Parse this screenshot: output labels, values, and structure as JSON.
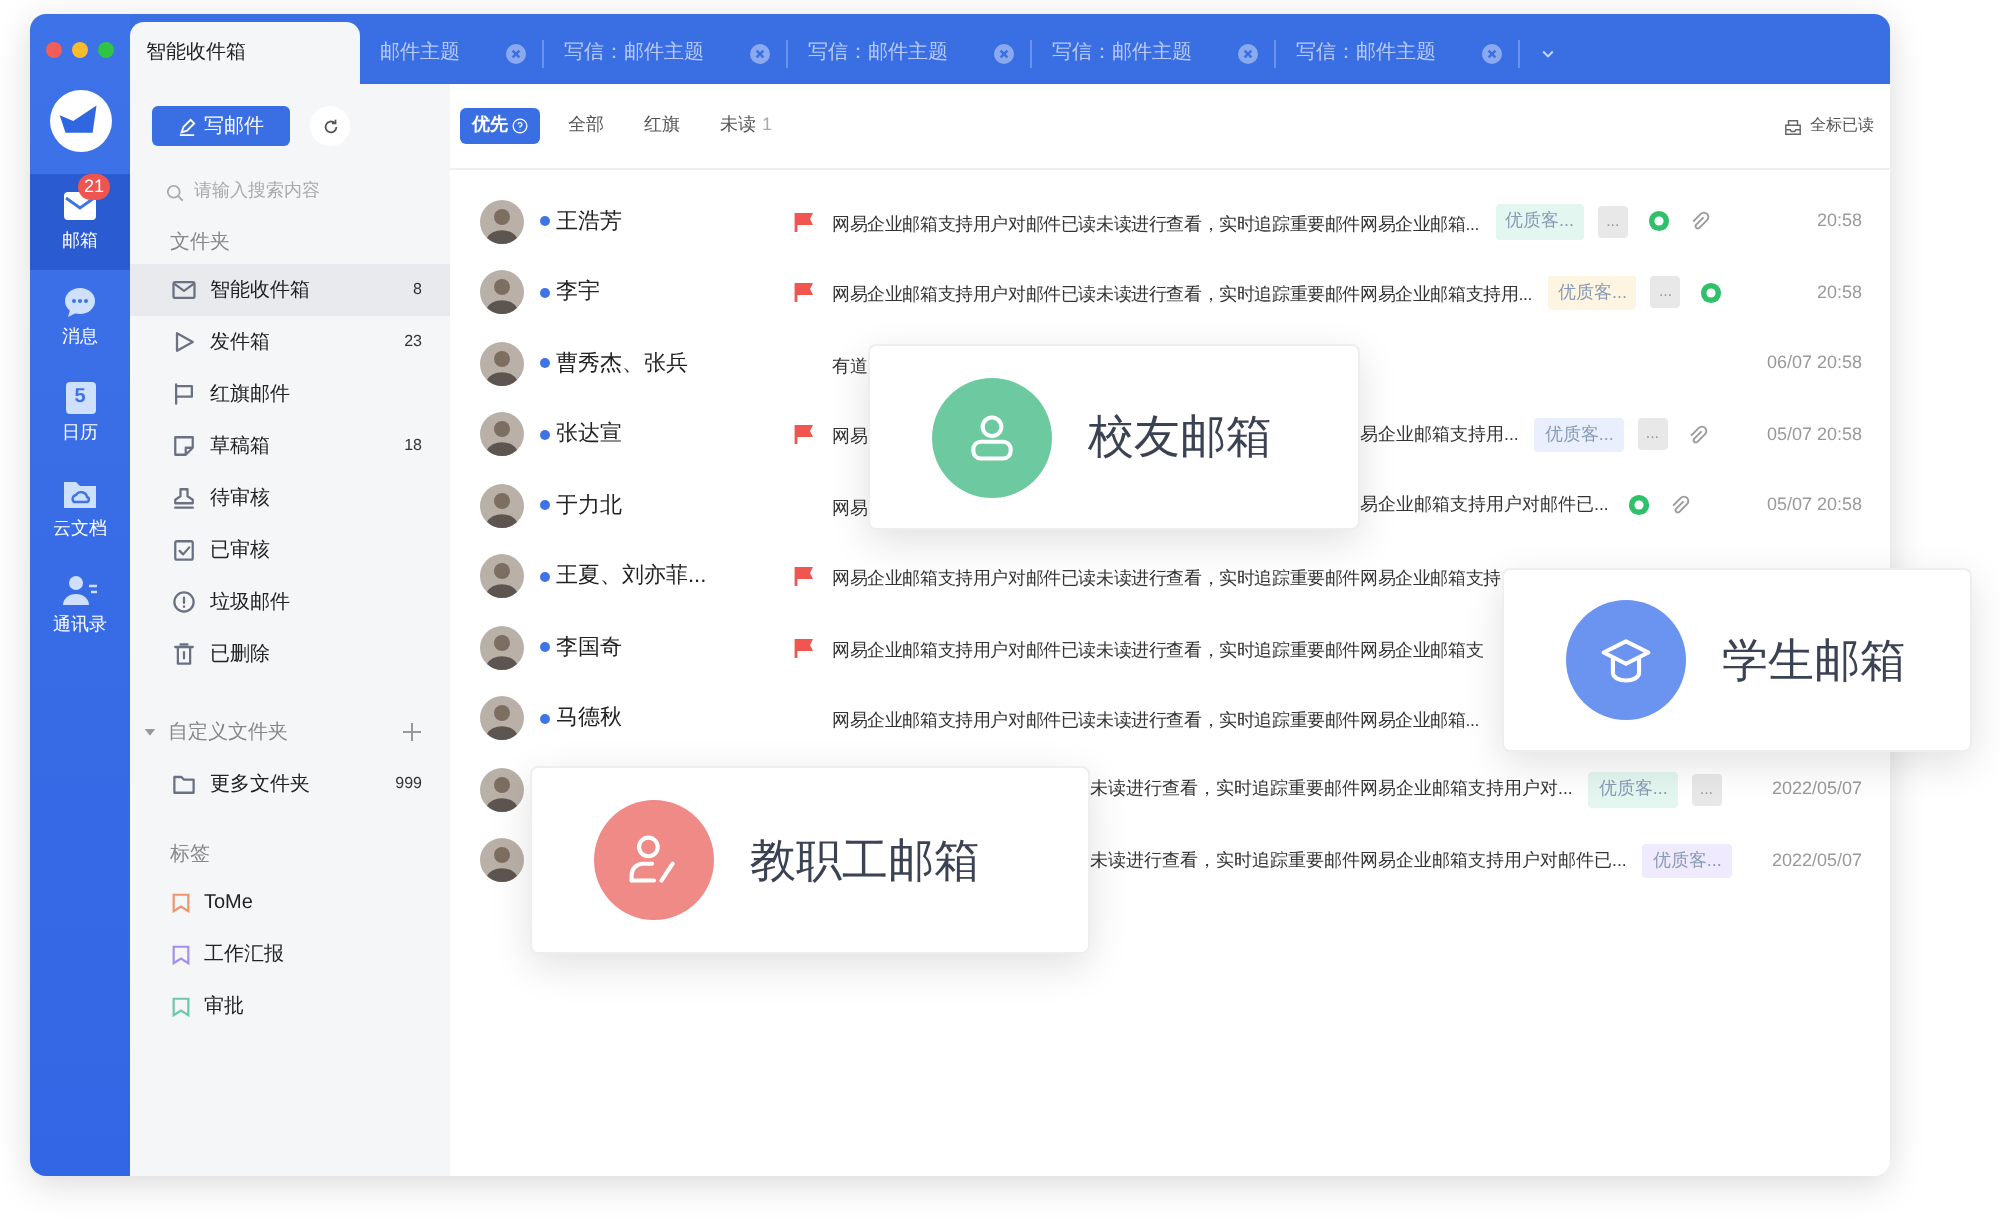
{
  "window_tabs": [
    {
      "label": "智能收件箱",
      "selected": true,
      "closable": false
    },
    {
      "label": "邮件主题",
      "selected": false,
      "closable": true
    },
    {
      "label": "写信：邮件主题",
      "selected": false,
      "closable": true
    },
    {
      "label": "写信：邮件主题",
      "selected": false,
      "closable": true
    },
    {
      "label": "写信：邮件主题",
      "selected": false,
      "closable": true
    },
    {
      "label": "写信：邮件主题",
      "selected": false,
      "closable": true
    }
  ],
  "rail": [
    {
      "kind": "mail",
      "label": "邮箱",
      "selected": true,
      "badge": "21"
    },
    {
      "kind": "chat",
      "label": "消息",
      "selected": false
    },
    {
      "kind": "calendar",
      "label": "日历",
      "selected": false,
      "icon_text": "5"
    },
    {
      "kind": "docs",
      "label": "云文档",
      "selected": false
    },
    {
      "kind": "contacts",
      "label": "通讯录",
      "selected": false
    }
  ],
  "compose_button": "写邮件",
  "search": {
    "placeholder": "请输入搜索内容"
  },
  "folders_header": "文件夹",
  "folders": [
    {
      "kind": "inbox",
      "label": "智能收件箱",
      "count": "8",
      "selected": true
    },
    {
      "kind": "sent",
      "label": "发件箱",
      "count": "23",
      "selected": false
    },
    {
      "kind": "flag",
      "label": "红旗邮件",
      "selected": false
    },
    {
      "kind": "draft",
      "label": "草稿箱",
      "count": "18",
      "selected": false
    },
    {
      "kind": "pending",
      "label": "待审核",
      "selected": false
    },
    {
      "kind": "approved",
      "label": "已审核",
      "selected": false
    },
    {
      "kind": "spam",
      "label": "垃圾邮件",
      "selected": false
    },
    {
      "kind": "trash",
      "label": "已删除",
      "selected": false
    }
  ],
  "custom_folders": {
    "label": "自定义文件夹",
    "expanded": true,
    "items": [
      {
        "label": "更多文件夹",
        "count": "999"
      }
    ]
  },
  "tags_header": "标签",
  "tags": [
    {
      "label": "ToMe",
      "color": "#f0956a"
    },
    {
      "label": "工作汇报",
      "color": "#a48ef0"
    },
    {
      "label": "审批",
      "color": "#6cc9a8"
    }
  ],
  "filters": [
    {
      "label": "优先",
      "selected": true,
      "help": true
    },
    {
      "label": "全部",
      "selected": false
    },
    {
      "label": "红旗",
      "selected": false
    },
    {
      "label": "未读",
      "selected": false,
      "count": "1"
    }
  ],
  "mark_all_read": "全标已读",
  "mails": [
    {
      "sender": "王浩芳",
      "unread": true,
      "flagged": true,
      "subject": "网易企业邮箱支持用户对邮件已读未读进行查看，实时追踪重要邮件网易企业邮箱...",
      "tag": {
        "label": "优质客...",
        "color": "#e3f6f0"
      },
      "more": "...",
      "wechat": true,
      "attachment": true,
      "time": "20:58"
    },
    {
      "sender": "李宇",
      "unread": true,
      "flagged": true,
      "subject": "网易企业邮箱支持用户对邮件已读未读进行查看，实时追踪重要邮件网易企业邮箱支持用...",
      "tag": {
        "label": "优质客...",
        "color": "#fdf5e1"
      },
      "more": "...",
      "wechat": true,
      "attachment": false,
      "time": "20:58"
    },
    {
      "sender": "曹秀杰、张兵",
      "unread": true,
      "flagged": false,
      "subject": "有道",
      "time": "06/07 20:58"
    },
    {
      "sender": "张达宣",
      "unread": true,
      "flagged": true,
      "subject": "网易",
      "subject_tail": "易企业邮箱支持用...",
      "tag": {
        "label": "优质客...",
        "color": "#e9effd"
      },
      "more": "...",
      "wechat": false,
      "attachment": true,
      "time": "05/07 20:58"
    },
    {
      "sender": "于力北",
      "unread": true,
      "flagged": false,
      "subject": "网易",
      "subject_tail": "易企业邮箱支持用户对邮件已...",
      "wechat": true,
      "attachment": true,
      "time": "05/07 20:58"
    },
    {
      "sender": "王夏、刘亦菲...",
      "unread": true,
      "flagged": true,
      "subject": "网易企业邮箱支持用户对邮件已读未读进行查看，实时追踪重要邮件网易企业邮箱支持"
    },
    {
      "sender": "李国奇",
      "unread": true,
      "flagged": true,
      "subject": "网易企业邮箱支持用户对邮件已读未读进行查看，实时追踪重要邮件网易企业邮箱支"
    },
    {
      "sender": "马德秋",
      "unread": true,
      "flagged": false,
      "subject": "网易企业邮箱支持用户对邮件已读未读进行查看，实时追踪重要邮件网易企业邮箱..."
    },
    {
      "subject_tail": "未读进行查看，实时追踪重要邮件网易企业邮箱支持用户对...",
      "tag": {
        "label": "优质客...",
        "color": "#e3f6f0"
      },
      "more": "...",
      "time": "2022/05/07"
    },
    {
      "subject_tail": "未读进行查看，实时追踪重要邮件网易企业邮箱支持用户对邮件已...",
      "tag": {
        "label": "优质客...",
        "color": "#efeafd"
      },
      "time": "2022/05/07"
    }
  ],
  "feature_cards": [
    {
      "kind": "alumni",
      "label": "校友邮箱",
      "color": "#6cc9a0"
    },
    {
      "kind": "student",
      "label": "学生邮箱",
      "color": "#6b93f0"
    },
    {
      "kind": "staff",
      "label": "教职工邮箱",
      "color": "#ef8a86"
    }
  ]
}
